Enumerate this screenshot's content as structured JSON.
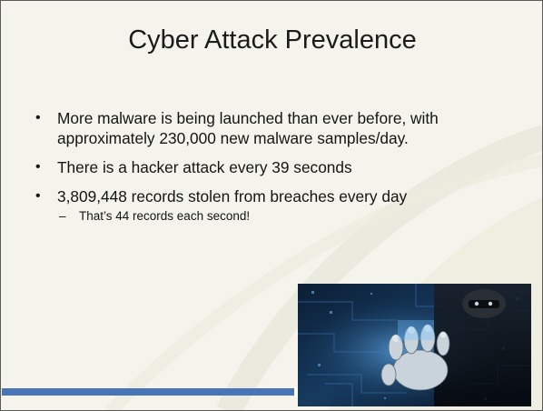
{
  "slide": {
    "title": "Cyber Attack Prevalence",
    "bullets": [
      "More malware is being launched than ever before, with approximately 230,000 new malware samples/day.",
      "There is a hacker attack every 39 seconds",
      "3,809,448 records stolen from breaches every day"
    ],
    "sub_bullet": "That’s 44 records each second!",
    "bullet_symbol": "•",
    "sub_bullet_symbol": "–"
  },
  "colors": {
    "background": "#f4f4ec",
    "footer_bar": "#4a74b8",
    "image_accent": "#2a6fbf"
  },
  "image": {
    "icon": "hacker-hand-icon"
  }
}
